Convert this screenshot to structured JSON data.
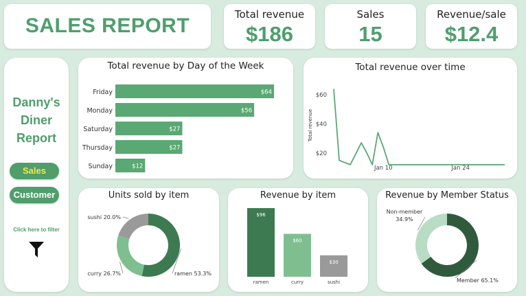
{
  "header": {
    "title": "SALES REPORT"
  },
  "kpis": [
    {
      "label": "Total revenue",
      "value": "$186"
    },
    {
      "label": "Sales",
      "value": "15"
    },
    {
      "label": "Revenue/sale",
      "value": "$12.4"
    }
  ],
  "sidebar": {
    "title_lines": [
      "Danny's",
      "Diner",
      "Report"
    ],
    "buttons": [
      {
        "label": "Sales",
        "text_color": "#f2e84a"
      },
      {
        "label": "Customer",
        "text_color": "#ffffff"
      }
    ],
    "filter_hint": "Click here to filter",
    "filter_icon": "funnel-icon"
  },
  "colors": {
    "accent": "#4f9e6c",
    "bar": "#5aa873",
    "dark_green": "#3d7a52",
    "mid_green": "#7fbf8f",
    "light_green": "#b8dcc4",
    "grey": "#9a9a9a",
    "darkest_green": "#2f5a3c",
    "background": "#d8ebdf"
  },
  "chart_data": [
    {
      "type": "bar",
      "orientation": "horizontal",
      "title": "Total revenue by Day of the Week",
      "categories": [
        "Friday",
        "Monday",
        "Saturday",
        "Thursday",
        "Sunday"
      ],
      "values": [
        64,
        56,
        27,
        27,
        12
      ],
      "data_labels": [
        "$64",
        "$56",
        "$27",
        "$27",
        "$12"
      ],
      "xlim": [
        0,
        70
      ]
    },
    {
      "type": "line",
      "title": "Total revenue over time",
      "ylabel": "Total revenue",
      "x": [
        "2021-01-01",
        "2021-01-02",
        "2021-01-04",
        "2021-01-06",
        "2021-01-07",
        "2021-01-08",
        "2021-01-09",
        "2021-01-10",
        "2021-01-11",
        "2021-01-12",
        "2021-01-13",
        "2021-01-14",
        "2021-01-15",
        "2021-01-16",
        "2021-01-17",
        "2021-01-18",
        "2021-01-19",
        "2021-01-20",
        "2021-01-21",
        "2021-01-22",
        "2021-01-23",
        "2021-01-24",
        "2021-01-25",
        "2021-01-26",
        "2021-01-27",
        "2021-01-28",
        "2021-01-29",
        "2021-01-30",
        "2021-01-31",
        "2021-02-01"
      ],
      "values": [
        64,
        15,
        12,
        27,
        20,
        12,
        34,
        24,
        12,
        12,
        12,
        12,
        12,
        12,
        12,
        12,
        12,
        12,
        12,
        12,
        12,
        12,
        12,
        12,
        12,
        12,
        12,
        12,
        12,
        12
      ],
      "x_ticks": [
        {
          "date": "2021-01-10",
          "label": "Jan 10"
        },
        {
          "date": "2021-01-24",
          "label": "Jan 24"
        }
      ],
      "y_ticks": [
        {
          "value": 20,
          "label": "$20"
        },
        {
          "value": 40,
          "label": "$40"
        },
        {
          "value": 60,
          "label": "$60"
        }
      ],
      "ylim": [
        10,
        68
      ]
    },
    {
      "type": "pie",
      "variant": "donut",
      "title": "Units sold by item",
      "categories": [
        "ramen",
        "curry",
        "sushi"
      ],
      "values": [
        53.3,
        26.7,
        20.0
      ],
      "labels": [
        "ramen 53.3%",
        "curry 26.7%",
        "sushi 20.0%"
      ]
    },
    {
      "type": "bar",
      "title": "Revenue by item",
      "categories": [
        "ramen",
        "curry",
        "sushi"
      ],
      "values": [
        96,
        60,
        30
      ],
      "data_labels": [
        "$96",
        "$60",
        "$30"
      ],
      "ylim": [
        0,
        100
      ]
    },
    {
      "type": "pie",
      "variant": "donut",
      "title": "Revenue by Member Status",
      "categories": [
        "Member",
        "Non-member"
      ],
      "values": [
        65.1,
        34.9
      ],
      "labels": [
        "Member 65.1%",
        "Non-member 34.9%"
      ]
    }
  ]
}
